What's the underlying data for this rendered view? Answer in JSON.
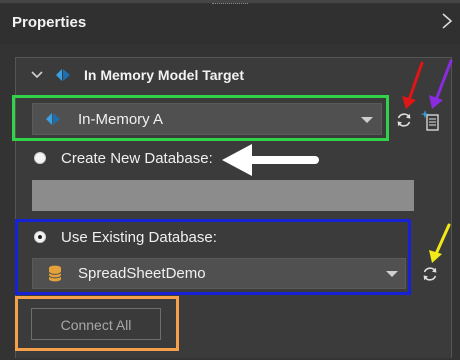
{
  "panel": {
    "title": "Properties"
  },
  "section": {
    "title": "In Memory Model Target",
    "expanded": true
  },
  "target": {
    "selected": "In-Memory A",
    "icon": "tabular-model-icon"
  },
  "options": {
    "create_label": "Create New Database:",
    "create_selected": false,
    "new_database_name": "",
    "existing_label": "Use Existing Database:",
    "existing_selected": true,
    "database_selected": "SpreadSheetDemo",
    "database_icon": "database-icon"
  },
  "actions": {
    "connect_label": "Connect All",
    "connect_enabled": false
  },
  "colors": {
    "background": "#333333",
    "panel": "#3b3b3b",
    "highlight_green": "#31d24a",
    "highlight_blue": "#1522d6",
    "highlight_orange": "#f5a04a",
    "arrow_red": "#e01515",
    "arrow_purple": "#8a2be2",
    "arrow_yellow": "#f2e81a",
    "arrow_white": "#ffffff",
    "accent_icon": "#3aa0e0",
    "db_icon": "#e5a23a"
  }
}
